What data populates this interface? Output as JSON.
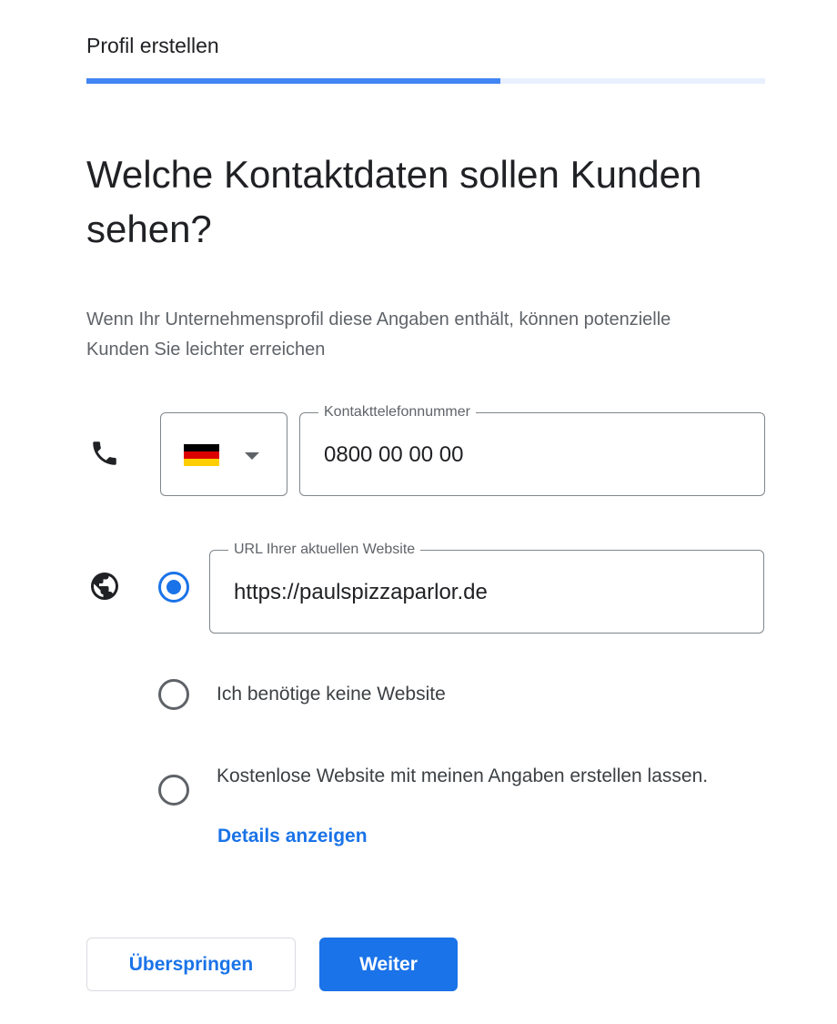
{
  "header": {
    "title": "Profil erstellen",
    "progress": 0.61
  },
  "main": {
    "heading": "Welche Kontaktdaten sollen Kunden sehen?",
    "description": "Wenn Ihr Unternehmensprofil diese Angaben enthält, können potenzielle Kunden Sie leichter erreichen"
  },
  "phone": {
    "icon": "phone-icon",
    "country_flag": "germany-flag-icon",
    "label": "Kontakttelefonnummer",
    "value": "0800 00 00 00"
  },
  "website": {
    "icon": "globe-icon",
    "options": [
      {
        "type": "url",
        "label": "URL Ihrer aktuellen Website",
        "value": "https://paulspizzaparlor.de",
        "selected": true
      },
      {
        "type": "none",
        "label": "Ich benötige keine Website",
        "selected": false
      },
      {
        "type": "free",
        "label": "Kostenlose Website mit meinen Angaben erstellen lassen.",
        "link": "Details anzeigen",
        "selected": false
      }
    ]
  },
  "actions": {
    "skip_label": "Überspringen",
    "next_label": "Weiter"
  },
  "colors": {
    "accent": "#1a73e8",
    "progress_fill": "#4285f4",
    "progress_track": "#e8f0fe"
  }
}
